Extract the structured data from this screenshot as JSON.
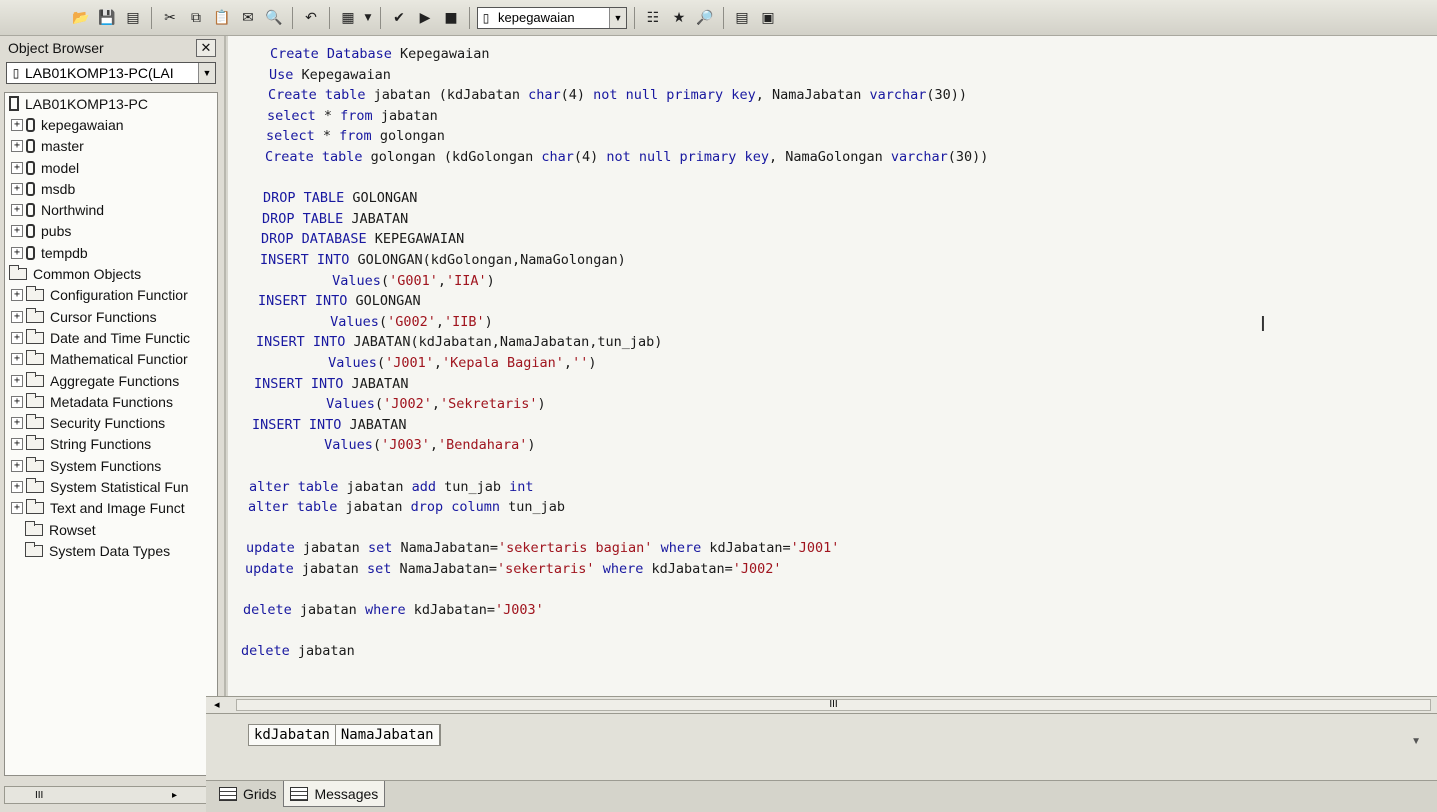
{
  "toolbar": {
    "database": "kepegawaian"
  },
  "object_browser": {
    "title": "Object Browser",
    "server_select": "LAB01KOMP13-PC(LAI",
    "tree": [
      {
        "label": "LAB01KOMP13-PC",
        "icon": "server-icon",
        "indent": 0,
        "expander": ""
      },
      {
        "label": "kepegawaian",
        "icon": "database-icon",
        "indent": 1,
        "expander": "+"
      },
      {
        "label": "master",
        "icon": "database-icon",
        "indent": 1,
        "expander": "+"
      },
      {
        "label": "model",
        "icon": "database-icon",
        "indent": 1,
        "expander": "+"
      },
      {
        "label": "msdb",
        "icon": "database-icon",
        "indent": 1,
        "expander": "+"
      },
      {
        "label": "Northwind",
        "icon": "database-icon",
        "indent": 1,
        "expander": "+"
      },
      {
        "label": "pubs",
        "icon": "database-icon",
        "indent": 1,
        "expander": "+"
      },
      {
        "label": "tempdb",
        "icon": "database-icon",
        "indent": 1,
        "expander": "+"
      },
      {
        "label": "Common Objects",
        "icon": "folder-icon",
        "indent": 0,
        "expander": ""
      },
      {
        "label": "Configuration Functior",
        "icon": "folder-icon",
        "indent": 1,
        "expander": "+"
      },
      {
        "label": "Cursor Functions",
        "icon": "folder-icon",
        "indent": 1,
        "expander": "+"
      },
      {
        "label": "Date and Time Functic",
        "icon": "folder-icon",
        "indent": 1,
        "expander": "+"
      },
      {
        "label": "Mathematical Functior",
        "icon": "folder-icon",
        "indent": 1,
        "expander": "+"
      },
      {
        "label": "Aggregate Functions",
        "icon": "folder-icon",
        "indent": 1,
        "expander": "+"
      },
      {
        "label": "Metadata Functions",
        "icon": "folder-icon",
        "indent": 1,
        "expander": "+"
      },
      {
        "label": "Security Functions",
        "icon": "folder-icon",
        "indent": 1,
        "expander": "+"
      },
      {
        "label": "String Functions",
        "icon": "folder-icon",
        "indent": 1,
        "expander": "+"
      },
      {
        "label": "System Functions",
        "icon": "folder-icon",
        "indent": 1,
        "expander": "+"
      },
      {
        "label": "System Statistical Fun",
        "icon": "folder-icon",
        "indent": 1,
        "expander": "+"
      },
      {
        "label": "Text and Image Funct",
        "icon": "folder-icon",
        "indent": 1,
        "expander": "+"
      },
      {
        "label": "Rowset",
        "icon": "folder-icon",
        "indent": 1,
        "expander": ""
      },
      {
        "label": "System Data Types",
        "icon": "folder-icon",
        "indent": 1,
        "expander": ""
      }
    ]
  },
  "editor": {
    "lines": [
      [
        [
          "kw",
          "Create Database "
        ],
        [
          "txt",
          "Kepegawaian"
        ]
      ],
      [
        [
          "kw",
          "Use "
        ],
        [
          "txt",
          "Kepegawaian"
        ]
      ],
      [
        [
          "kw",
          "Create table "
        ],
        [
          "txt",
          "jabatan (kdJabatan "
        ],
        [
          "kw",
          "char"
        ],
        [
          "txt",
          "(4) "
        ],
        [
          "kw",
          "not null primary key"
        ],
        [
          "txt",
          ", NamaJabatan "
        ],
        [
          "kw",
          "varchar"
        ],
        [
          "txt",
          "(30))"
        ]
      ],
      [
        [
          "kw",
          "select "
        ],
        [
          "txt",
          "* "
        ],
        [
          "kw",
          "from "
        ],
        [
          "txt",
          "jabatan"
        ]
      ],
      [
        [
          "kw",
          "select "
        ],
        [
          "txt",
          "* "
        ],
        [
          "kw",
          "from "
        ],
        [
          "txt",
          "golongan"
        ]
      ],
      [
        [
          "kw",
          "Create table "
        ],
        [
          "txt",
          "golongan (kdGolongan "
        ],
        [
          "kw",
          "char"
        ],
        [
          "txt",
          "(4) "
        ],
        [
          "kw",
          "not null primary key"
        ],
        [
          "txt",
          ", NamaGolongan "
        ],
        [
          "kw",
          "varchar"
        ],
        [
          "txt",
          "(30))"
        ]
      ],
      [],
      [
        [
          "kw",
          "DROP TABLE "
        ],
        [
          "txt",
          "GOLONGAN"
        ]
      ],
      [
        [
          "kw",
          "DROP TABLE "
        ],
        [
          "txt",
          "JABATAN"
        ]
      ],
      [
        [
          "kw",
          "DROP DATABASE "
        ],
        [
          "txt",
          "KEPEGAWAIAN"
        ]
      ],
      [
        [
          "kw",
          "INSERT INTO "
        ],
        [
          "txt",
          "GOLONGAN(kdGolongan,NamaGolongan)"
        ]
      ],
      [
        [
          "txt",
          "         "
        ],
        [
          "kw",
          "Values"
        ],
        [
          "txt",
          "("
        ],
        [
          "str",
          "'G001'"
        ],
        [
          "txt",
          ","
        ],
        [
          "str",
          "'IIA'"
        ],
        [
          "txt",
          ")"
        ]
      ],
      [
        [
          "kw",
          "INSERT INTO "
        ],
        [
          "txt",
          "GOLONGAN"
        ]
      ],
      [
        [
          "txt",
          "         "
        ],
        [
          "kw",
          "Values"
        ],
        [
          "txt",
          "("
        ],
        [
          "str",
          "'G002'"
        ],
        [
          "txt",
          ","
        ],
        [
          "str",
          "'IIB'"
        ],
        [
          "txt",
          ")"
        ]
      ],
      [
        [
          "kw",
          "INSERT INTO "
        ],
        [
          "txt",
          "JABATAN(kdJabatan,NamaJabatan,tun_jab)"
        ]
      ],
      [
        [
          "txt",
          "         "
        ],
        [
          "kw",
          "Values"
        ],
        [
          "txt",
          "("
        ],
        [
          "str",
          "'J001'"
        ],
        [
          "txt",
          ","
        ],
        [
          "str",
          "'Kepala Bagian'"
        ],
        [
          "txt",
          ","
        ],
        [
          "str",
          "''"
        ],
        [
          "txt",
          ")"
        ]
      ],
      [
        [
          "kw",
          "INSERT INTO "
        ],
        [
          "txt",
          "JABATAN"
        ]
      ],
      [
        [
          "txt",
          "         "
        ],
        [
          "kw",
          "Values"
        ],
        [
          "txt",
          "("
        ],
        [
          "str",
          "'J002'"
        ],
        [
          "txt",
          ","
        ],
        [
          "str",
          "'Sekretaris'"
        ],
        [
          "txt",
          ")"
        ]
      ],
      [
        [
          "kw",
          "INSERT INTO "
        ],
        [
          "txt",
          "JABATAN"
        ]
      ],
      [
        [
          "txt",
          "         "
        ],
        [
          "kw",
          "Values"
        ],
        [
          "txt",
          "("
        ],
        [
          "str",
          "'J003'"
        ],
        [
          "txt",
          ","
        ],
        [
          "str",
          "'Bendahara'"
        ],
        [
          "txt",
          ")"
        ]
      ],
      [],
      [
        [
          "kw",
          "alter table "
        ],
        [
          "txt",
          "jabatan "
        ],
        [
          "kw",
          "add "
        ],
        [
          "txt",
          "tun_jab "
        ],
        [
          "kw",
          "int"
        ]
      ],
      [
        [
          "kw",
          "alter table "
        ],
        [
          "txt",
          "jabatan "
        ],
        [
          "kw",
          "drop column "
        ],
        [
          "txt",
          "tun_jab"
        ]
      ],
      [],
      [
        [
          "kw",
          "update "
        ],
        [
          "txt",
          "jabatan "
        ],
        [
          "kw",
          "set "
        ],
        [
          "txt",
          "NamaJabatan="
        ],
        [
          "str",
          "'sekertaris bagian'"
        ],
        [
          "txt",
          " "
        ],
        [
          "kw",
          "where "
        ],
        [
          "txt",
          "kdJabatan="
        ],
        [
          "str",
          "'J001'"
        ]
      ],
      [
        [
          "kw",
          "update "
        ],
        [
          "txt",
          "jabatan "
        ],
        [
          "kw",
          "set "
        ],
        [
          "txt",
          "NamaJabatan="
        ],
        [
          "str",
          "'sekertaris'"
        ],
        [
          "txt",
          " "
        ],
        [
          "kw",
          "where "
        ],
        [
          "txt",
          "kdJabatan="
        ],
        [
          "str",
          "'J002'"
        ]
      ],
      [],
      [
        [
          "kw",
          "delete "
        ],
        [
          "txt",
          "jabatan "
        ],
        [
          "kw",
          "where "
        ],
        [
          "txt",
          "kdJabatan="
        ],
        [
          "str",
          "'J003'"
        ]
      ],
      [],
      [
        [
          "kw",
          "delete "
        ],
        [
          "txt",
          "jabatan"
        ]
      ]
    ]
  },
  "results": {
    "columns": [
      "kdJabatan",
      "NamaJabatan"
    ]
  },
  "tabs": [
    {
      "label": "Grids",
      "icon": "grid-icon",
      "active": false
    },
    {
      "label": "Messages",
      "icon": "messages-icon",
      "active": true
    }
  ],
  "scroll_marker": "III"
}
